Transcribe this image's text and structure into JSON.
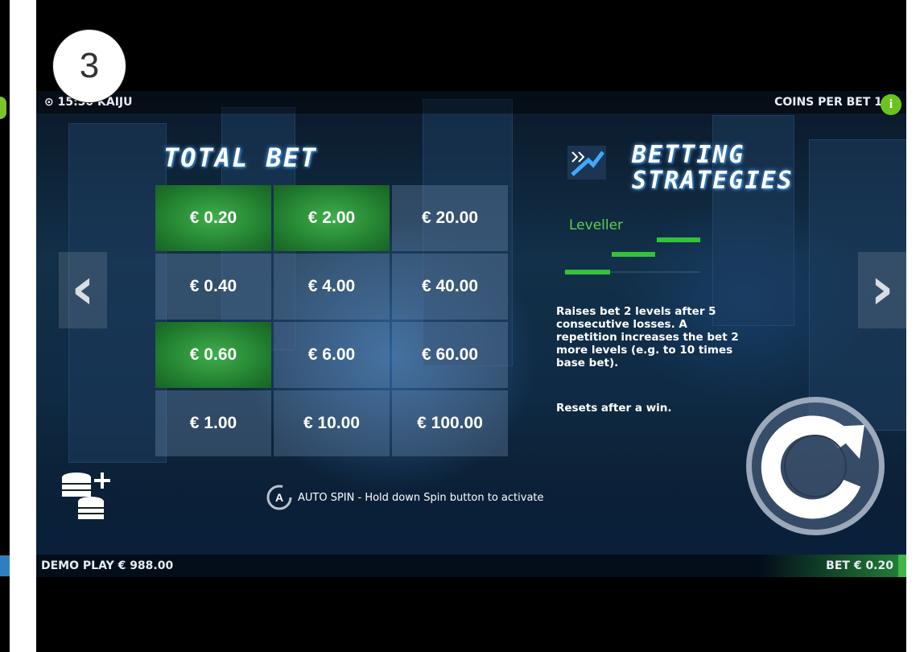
{
  "step_badge": "3",
  "top_bar": {
    "clock": "⊙ 15:50 KAIJU",
    "coins_per_bet": "COINS PER BET 1"
  },
  "total_bet": {
    "title": "TOTAL BET",
    "options": [
      "€ 0.20",
      "€ 2.00",
      "€ 20.00",
      "€ 0.40",
      "€ 4.00",
      "€ 40.00",
      "€ 0.60",
      "€ 6.00",
      "€ 60.00",
      "€ 1.00",
      "€ 10.00",
      "€ 100.00"
    ],
    "selected": "€ 0.20"
  },
  "strategies": {
    "title_line1": "BETTING",
    "title_line2": "STRATEGIES",
    "name": "Leveller",
    "description": "Raises bet 2 levels after 5 consecutive losses. A repetition increases the bet 2 more levels (e.g. to 10 times base bet).",
    "reset_note": "Resets after a win."
  },
  "autospin": {
    "text": "AUTO SPIN - Hold down Spin button to activate",
    "icon_letter": "A"
  },
  "bottom_bar": {
    "balance": "DEMO PLAY € 988.00",
    "bet": "BET € 0.20"
  },
  "icons": {
    "info": "i",
    "prev": "‹",
    "next": "›",
    "coins": "coins-stack-plus-icon",
    "spin": "spin-arrow-icon"
  },
  "colors": {
    "accent_green": "#3fae4c",
    "leveller_green": "#5fcf4f",
    "info_green": "#6cc31f"
  }
}
